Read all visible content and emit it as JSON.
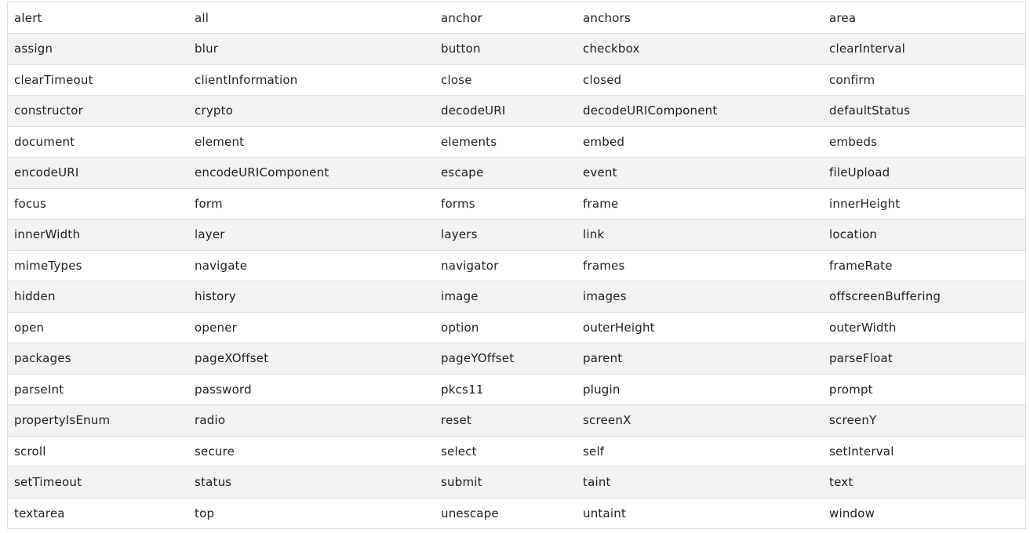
{
  "table": {
    "rows": [
      [
        "alert",
        "all",
        "anchor",
        "anchors",
        "area"
      ],
      [
        "assign",
        "blur",
        "button",
        "checkbox",
        "clearInterval"
      ],
      [
        "clearTimeout",
        "clientInformation",
        "close",
        "closed",
        "confirm"
      ],
      [
        "constructor",
        "crypto",
        "decodeURI",
        "decodeURIComponent",
        "defaultStatus"
      ],
      [
        "document",
        "element",
        "elements",
        "embed",
        "embeds"
      ],
      [
        "encodeURI",
        "encodeURIComponent",
        "escape",
        "event",
        "fileUpload"
      ],
      [
        "focus",
        "form",
        "forms",
        "frame",
        "innerHeight"
      ],
      [
        "innerWidth",
        "layer",
        "layers",
        "link",
        "location"
      ],
      [
        "mimeTypes",
        "navigate",
        "navigator",
        "frames",
        "frameRate"
      ],
      [
        "hidden",
        "history",
        "image",
        "images",
        "offscreenBuffering"
      ],
      [
        "open",
        "opener",
        "option",
        "outerHeight",
        "outerWidth"
      ],
      [
        "packages",
        "pageXOffset",
        "pageYOffset",
        "parent",
        "parseFloat"
      ],
      [
        "parseInt",
        "password",
        "pkcs11",
        "plugin",
        "prompt"
      ],
      [
        "propertyIsEnum",
        "radio",
        "reset",
        "screenX",
        "screenY"
      ],
      [
        "scroll",
        "secure",
        "select",
        "self",
        "setInterval"
      ],
      [
        "setTimeout",
        "status",
        "submit",
        "taint",
        "text"
      ],
      [
        "textarea",
        "top",
        "unescape",
        "untaint",
        "window"
      ]
    ]
  },
  "colors": {
    "row_alt": "#f2f2f2",
    "row_base": "#ffffff",
    "border": "#dcdcdc",
    "text": "#222222"
  }
}
